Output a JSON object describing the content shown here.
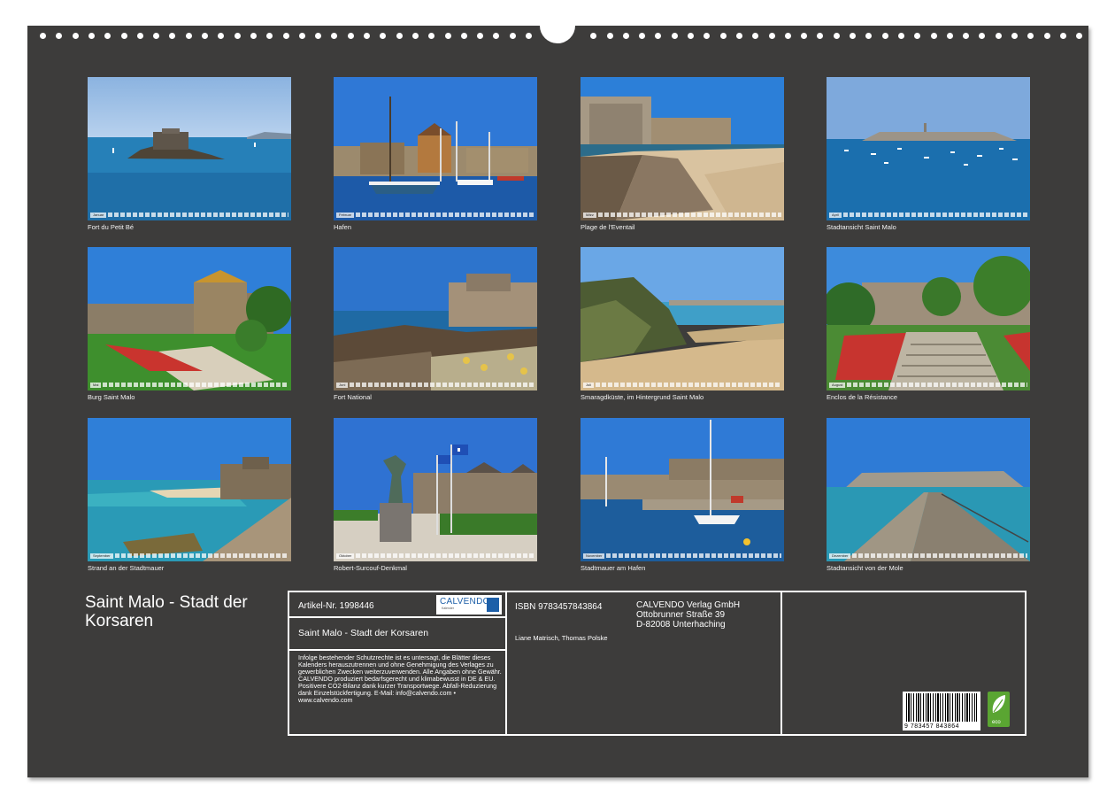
{
  "calendar_title": "Saint Malo - Stadt der Korsaren",
  "months": [
    {
      "strip": "Januar",
      "caption": "Fort du Petit Bé"
    },
    {
      "strip": "Februar",
      "caption": "Hafen"
    },
    {
      "strip": "März",
      "caption": "Plage de l'Eventail"
    },
    {
      "strip": "April",
      "caption": "Stadtansicht Saint Malo"
    },
    {
      "strip": "Mai",
      "caption": "Burg Saint Malo"
    },
    {
      "strip": "Juni",
      "caption": "Fort National"
    },
    {
      "strip": "Juli",
      "caption": "Smaragdküste, im Hintergrund Saint Malo"
    },
    {
      "strip": "August",
      "caption": "Enclos de la Résistance"
    },
    {
      "strip": "September",
      "caption": "Strand an der Stadtmauer"
    },
    {
      "strip": "Oktober",
      "caption": "Robert-Surcouf-Denkmal"
    },
    {
      "strip": "November",
      "caption": "Stadtmauer am Hafen"
    },
    {
      "strip": "Dezember",
      "caption": "Stadtansicht von der Mole"
    }
  ],
  "info": {
    "article": "Artikel-Nr. 1998446",
    "logo_text": "CALVENDO",
    "logo_sub": "Kalender",
    "product_title": "Saint Malo - Stadt der Korsaren",
    "legal": "Infolge bestehender Schutzrechte ist es untersagt, die Blätter dieses Kalenders herauszutrennen und ohne Genehmigung des Verlages zu gewerblichen Zwecken weiterzuverwenden. Alle Angaben ohne Gewähr. CALVENDO produziert bedarfsgerecht und klimabewusst in DE & EU. Positivere CO2-Bilanz dank kurzer Transportwege. Abfall-Reduzierung dank Einzelstückfertigung. E-Mail: info@calvendo.com • www.calvendo.com",
    "isbn": "ISBN 9783457843864",
    "publisher_name": "CALVENDO Verlag GmbH",
    "publisher_street": "Ottobrunner Straße 39",
    "publisher_city": "D-82008 Unterhaching",
    "authors": "Liane Matrisch, Thomas Polske",
    "barcode_number": "9 783457 843864",
    "eco_label": "eco"
  },
  "colors": {
    "background": "#3d3c3b",
    "text": "#ffffff",
    "eco_green": "#5aa532"
  }
}
